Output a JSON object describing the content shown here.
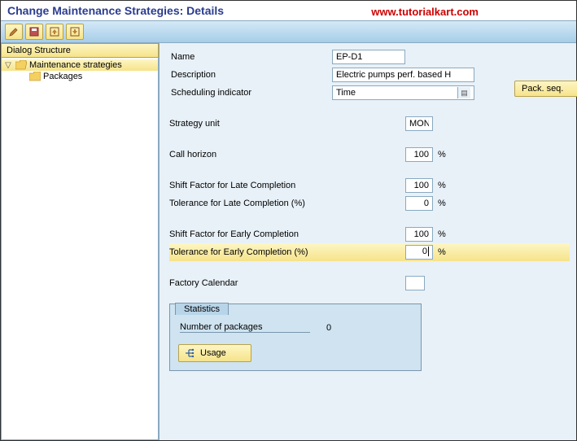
{
  "title": "Change Maintenance Strategies: Details",
  "watermark": "www.tutorialkart.com",
  "tree": {
    "header": "Dialog Structure",
    "items": [
      {
        "label": "Maintenance strategies",
        "open": true,
        "selected": true
      },
      {
        "label": "Packages",
        "open": false,
        "selected": false
      }
    ]
  },
  "form": {
    "name_label": "Name",
    "name_value": "EP-D1",
    "description_label": "Description",
    "description_value": "Electric pumps perf. based H",
    "sched_label": "Scheduling indicator",
    "sched_value": "Time",
    "pack_seq_label": "Pack. seq.",
    "unit_label": "Strategy unit",
    "unit_value": "MON",
    "call_horizon_label": "Call horizon",
    "call_horizon_value": "100",
    "shift_late_label": "Shift Factor for Late Completion",
    "shift_late_value": "100",
    "tol_late_label": "Tolerance for Late Completion (%)",
    "tol_late_value": "0",
    "shift_early_label": "Shift Factor for Early Completion",
    "shift_early_value": "100",
    "tol_early_label": "Tolerance for Early Completion (%)",
    "tol_early_value": "0",
    "factory_cal_label": "Factory Calendar",
    "factory_cal_value": "",
    "pct": "%"
  },
  "stats": {
    "title": "Statistics",
    "packages_label": "Number of packages",
    "packages_value": "0",
    "usage_label": "Usage"
  }
}
